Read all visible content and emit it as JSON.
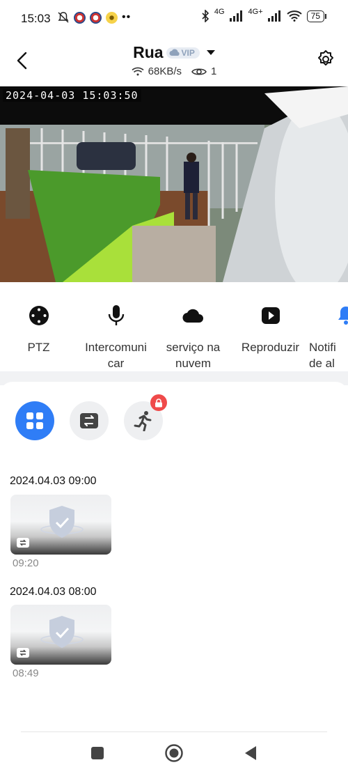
{
  "status_bar": {
    "time": "15:03",
    "network1": "4G",
    "network2": "4G+",
    "battery": "75"
  },
  "header": {
    "title": "Rua",
    "vip_label": "VIP",
    "speed": "68KB/s",
    "viewers": "1"
  },
  "video": {
    "timestamp": "2024-04-03  15:03:50"
  },
  "actions": [
    {
      "label": "PTZ",
      "icon": "ptz-icon"
    },
    {
      "label": "Intercomuni\ncar",
      "icon": "microphone-icon"
    },
    {
      "label": "serviço na\nnuvem",
      "icon": "cloud-icon"
    },
    {
      "label": "Reproduzir",
      "icon": "play-icon"
    },
    {
      "label": "Notifi\nde al",
      "icon": "bell-icon"
    }
  ],
  "filters": [
    {
      "name": "all-events",
      "icon": "grid-icon",
      "active": true
    },
    {
      "name": "motion-switch",
      "icon": "swap-icon",
      "active": false
    },
    {
      "name": "human-detection",
      "icon": "running-person-icon",
      "active": false,
      "locked": true
    }
  ],
  "groups": [
    {
      "title": "2024.04.03 09:00",
      "items": [
        {
          "time": "09:20"
        }
      ]
    },
    {
      "title": "2024.04.03 08:00",
      "items": [
        {
          "time": "08:49"
        }
      ]
    }
  ],
  "colors": {
    "accent": "#2f7df6",
    "lock_badge": "#ef4a4a"
  }
}
